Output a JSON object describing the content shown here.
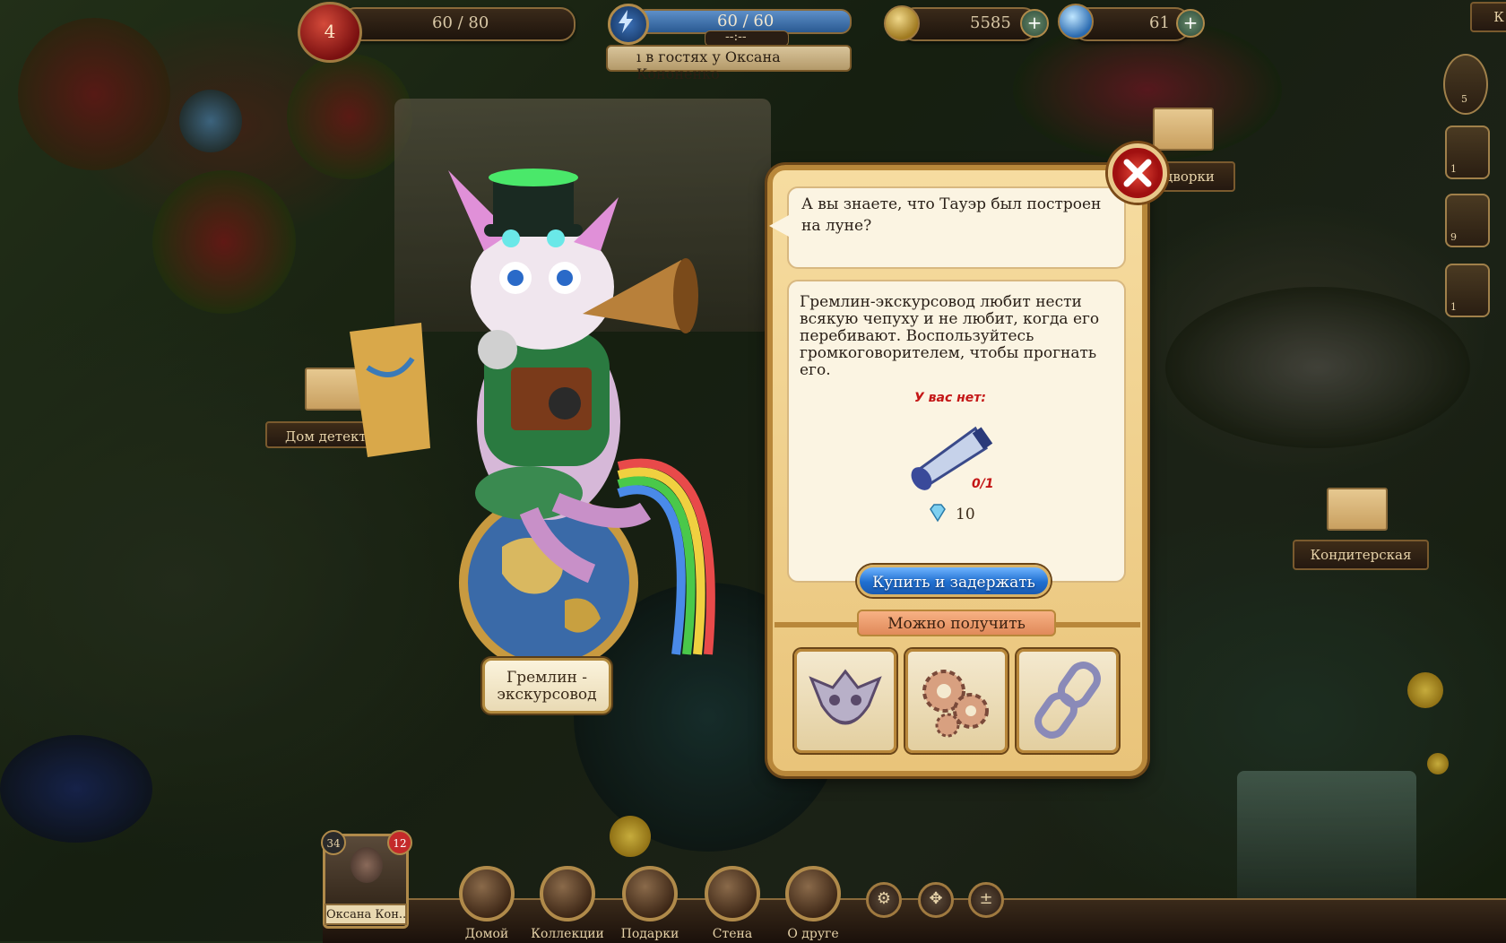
{
  "hud": {
    "lives": "4",
    "lives_bar": "60 / 80",
    "energy_bar": "60 / 60",
    "energy_timer": "--:--",
    "visit_text": "ı в гостях у Оксана Кононенко",
    "coins": "5585",
    "gems": "61",
    "corner_label": "К"
  },
  "quests": {
    "first_count": "5",
    "items": [
      "1",
      "9",
      "1"
    ]
  },
  "signs": {
    "left_sign": "Дом детект",
    "right_top_sign": "дворки",
    "right_sign": "Кондитерская"
  },
  "character": {
    "name": "Гремлин - экскурсовод"
  },
  "dialog": {
    "speech": "А вы знаете, что Тауэр был построен на луне?",
    "description": "Гремлин-экскурсовод любит нести всякую чепуху и не любит, когда его перебивают. Воспользуйтесь громкоговорителем, чтобы прогнать его.",
    "missing_label": "У вас нет:",
    "item_count": "0/1",
    "price": "10",
    "buy_button": "Купить и задержать",
    "rewards_label": "Можно получить",
    "rewards": [
      "goblin-mask",
      "gears",
      "chain"
    ]
  },
  "bottom": {
    "player_name": "Оксана Кон...",
    "player_level": "34",
    "player_badge": "12",
    "nav": [
      "Домой",
      "Коллекции",
      "Подарки",
      "Стена",
      "О друге"
    ]
  },
  "colors": {
    "dialog_bg": "#f6dca0",
    "dialog_border": "#b8873a",
    "buy_button": "#1f6fd0",
    "warning_red": "#c41616",
    "reward_label": "#f7b184"
  }
}
